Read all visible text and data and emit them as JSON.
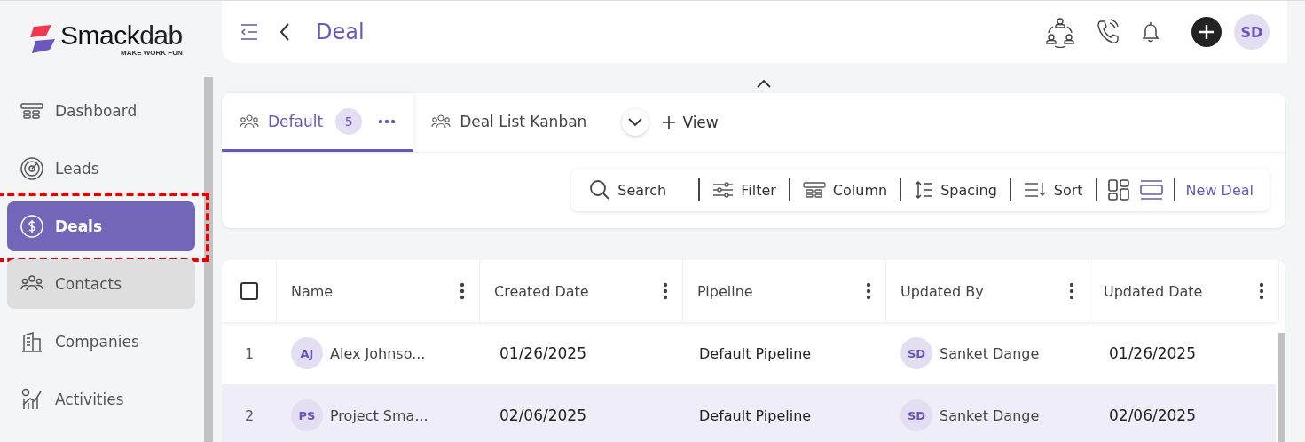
{
  "logo": {
    "name": "Smack",
    "name_light": "dab",
    "tagline": "MAKE WORK FUN"
  },
  "sidebar": {
    "items": [
      {
        "label": "Dashboard",
        "kind": "dashboard",
        "selected": false,
        "hovered": false,
        "highlighted": false
      },
      {
        "label": "Leads",
        "kind": "target",
        "selected": false,
        "hovered": false,
        "highlighted": false
      },
      {
        "label": "Deals",
        "kind": "dollar",
        "selected": true,
        "hovered": false,
        "highlighted": true
      },
      {
        "label": "Contacts",
        "kind": "people",
        "selected": false,
        "hovered": true,
        "highlighted": false
      },
      {
        "label": "Companies",
        "kind": "building",
        "selected": false,
        "hovered": false,
        "highlighted": false
      },
      {
        "label": "Activities",
        "kind": "chart",
        "selected": false,
        "hovered": false,
        "highlighted": false
      }
    ]
  },
  "header": {
    "title": "Deal",
    "avatar": "SD",
    "expanded": true
  },
  "views": {
    "tabs": [
      {
        "label": "Default",
        "count": "5",
        "selected": true
      },
      {
        "label": "Deal List Kanban",
        "selected": false
      }
    ],
    "add_label": "View"
  },
  "toolbar": {
    "items": [
      {
        "label": "Search",
        "kind": "search"
      },
      {
        "label": "Filter",
        "kind": "filter"
      },
      {
        "label": "Column",
        "kind": "column"
      },
      {
        "label": "Spacing",
        "kind": "spacing"
      },
      {
        "label": "Sort",
        "kind": "sort"
      }
    ],
    "layouts": [
      {
        "kind": "grid",
        "selected": false
      },
      {
        "kind": "rows",
        "selected": true
      }
    ],
    "new_label": "New Deal"
  },
  "table": {
    "all_checked": false,
    "columns": [
      "Name",
      "Created Date",
      "Pipeline",
      "Updated By",
      "Updated Date"
    ],
    "rows": [
      {
        "index": "1",
        "initials": "AJ",
        "name": "Alex Johnso...",
        "created": "01/26/2025",
        "pipeline": "Default Pipeline",
        "by_initials": "SD",
        "by": "Sanket Dange",
        "updated": "01/26/2025",
        "selected": false
      },
      {
        "index": "2",
        "initials": "PS",
        "name": "Project Sma...",
        "created": "02/06/2025",
        "pipeline": "Default Pipeline",
        "by_initials": "SD",
        "by": "Sanket Dange",
        "updated": "02/06/2025",
        "selected": true
      }
    ]
  }
}
